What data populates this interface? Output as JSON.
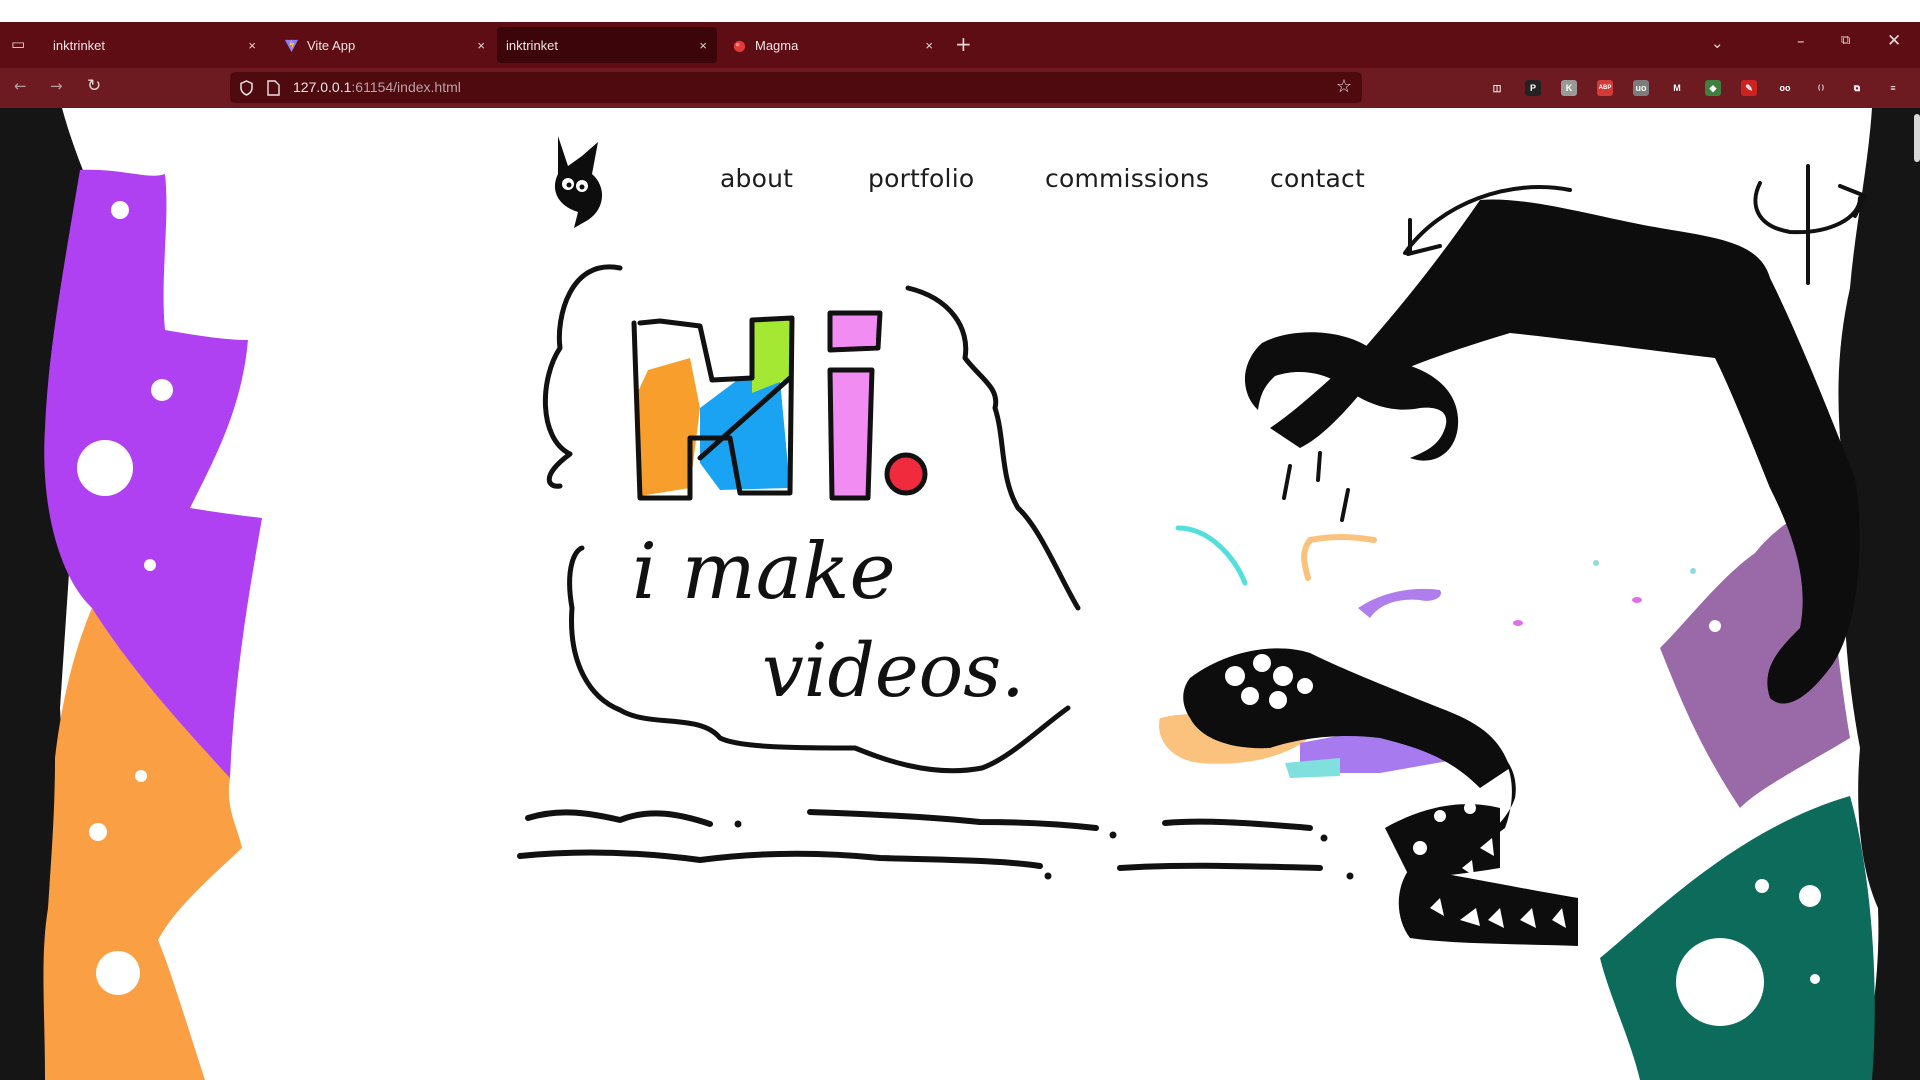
{
  "browser": {
    "tabs": [
      {
        "label": "inktrinket",
        "active": false,
        "favicon": "none"
      },
      {
        "label": "Vite App",
        "active": false,
        "favicon": "vite-icon"
      },
      {
        "label": "inktrinket",
        "active": true,
        "favicon": "none"
      },
      {
        "label": "Magma",
        "active": false,
        "favicon": "magma-icon"
      }
    ],
    "url_host": "127.0.0.1",
    "url_rest": ":61154/index.html",
    "new_tab_symbol": "+",
    "close_symbol": "×",
    "colors": {
      "tabbar": "#5e0d14",
      "toolbar": "#6d1a20",
      "urlbar": "#4e0a0f"
    }
  },
  "extensions": [
    {
      "name": "pocket-icon",
      "glyph": "◫",
      "color": "#6d1a20"
    },
    {
      "name": "p-extension-icon",
      "glyph": "P",
      "color": "#222222"
    },
    {
      "name": "k-extension-icon",
      "glyph": "K",
      "color": "#9a9a9a"
    },
    {
      "name": "adblock-icon",
      "glyph": "ABP",
      "color": "#d33a3a"
    },
    {
      "name": "ublock-icon",
      "glyph": "uo",
      "color": "#7c7c7c"
    },
    {
      "name": "m-extension-icon",
      "glyph": "M",
      "color": "#6d1a20"
    },
    {
      "name": "color-extension-icon",
      "glyph": "◆",
      "color": "#3f7f3f"
    },
    {
      "name": "pen-extension-icon",
      "glyph": "✎",
      "color": "#cc2222"
    },
    {
      "name": "glasses-extension-icon",
      "glyph": "oo",
      "color": "#6d1a20"
    },
    {
      "name": "brackets-extension-icon",
      "glyph": "( )",
      "color": "#6d1a20"
    },
    {
      "name": "puzzle-icon",
      "glyph": "⧉",
      "color": "#6d1a20"
    },
    {
      "name": "menu-icon",
      "glyph": "≡",
      "color": "#6d1a20"
    }
  ],
  "site": {
    "nav": [
      {
        "label": "about"
      },
      {
        "label": "portfolio"
      },
      {
        "label": "commissions"
      },
      {
        "label": "contact"
      }
    ],
    "hero_greeting": "Hi.",
    "hero_tagline": "i make videos.",
    "colors": {
      "purple": "#b041f2",
      "orange": "#fb9f45",
      "dark_side": "#151515",
      "right_purple": "#9a6aa8",
      "green": "#0d6b5c"
    }
  }
}
